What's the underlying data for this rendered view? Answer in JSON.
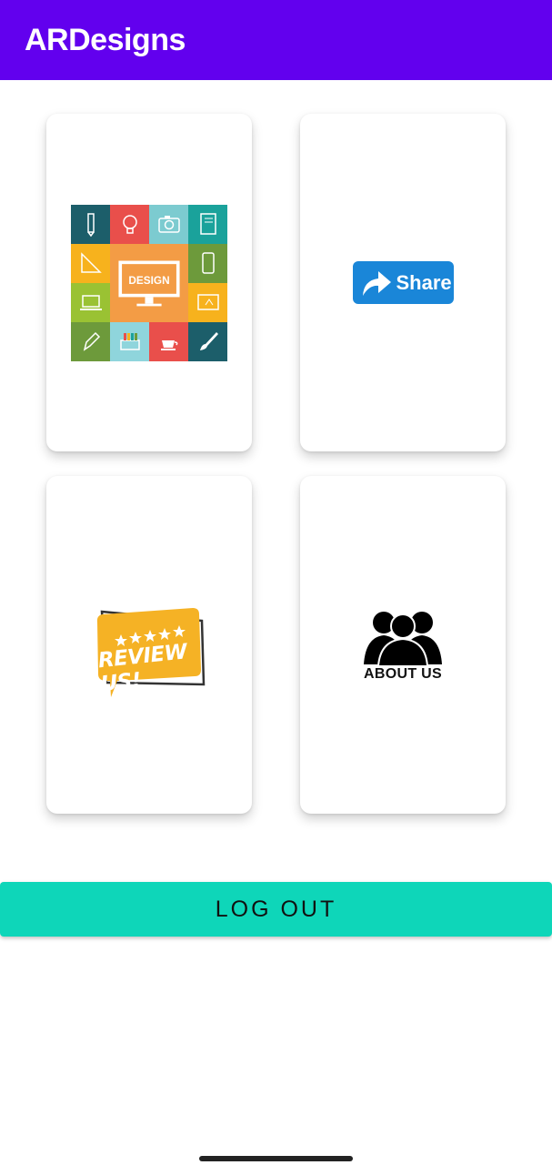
{
  "app_bar": {
    "title": "ARDesigns",
    "color": "#6200ee"
  },
  "cards": {
    "design": {
      "image_text": "DESIGN",
      "icon": "design-collage-icon"
    },
    "share": {
      "label": "Share",
      "icon": "share-arrow-icon",
      "color": "#1a86d8"
    },
    "review": {
      "label": "REVIEW US!",
      "icon": "review-stars-icon",
      "color": "#f5b225"
    },
    "about": {
      "label": "ABOUT US",
      "icon": "people-group-icon"
    }
  },
  "logout": {
    "label": "LOG OUT",
    "color": "#0ed6b9"
  }
}
